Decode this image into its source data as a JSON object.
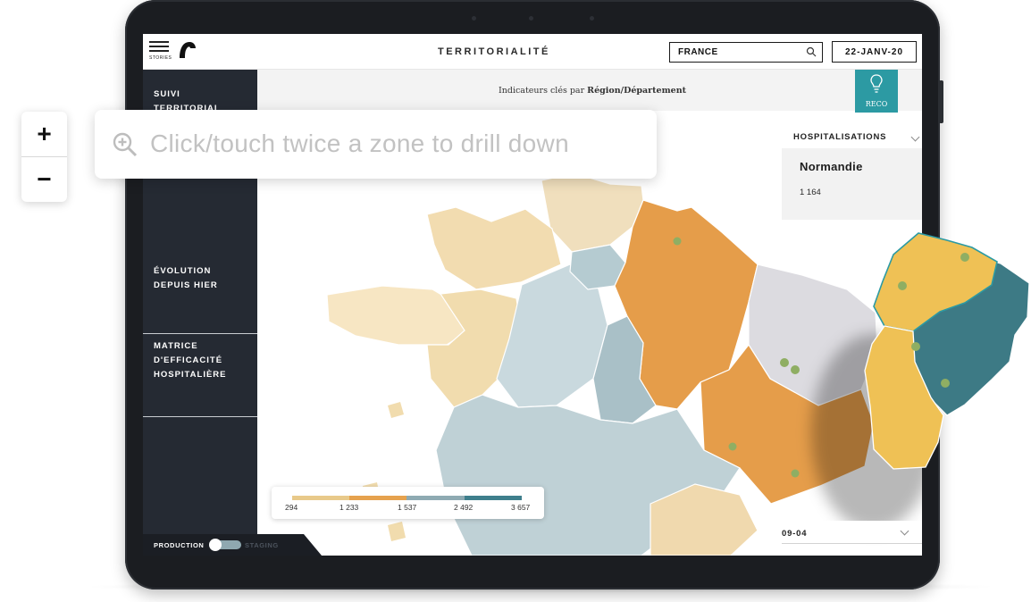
{
  "app": {
    "logo_label": "STORIES",
    "page_title": "TERRITORIALITÉ",
    "search_value": "FRANCE",
    "date_value": "22-JANV-20"
  },
  "sidebar": {
    "items": [
      {
        "label_line1": "SUIVI",
        "label_line2": "TERRITORIAL"
      },
      {
        "label_line1": "ÉVOLUTION",
        "label_line2": "DEPUIS HIER"
      },
      {
        "label_line1": "MATRICE",
        "label_line2": "D'EFFICACITÉ",
        "label_line3": "HOSPITALIÈRE"
      }
    ],
    "toggle": {
      "left_label": "PRODUCTION",
      "right_label": "STAGING"
    }
  },
  "header": {
    "indicator_prefix": "Indicateurs clés par",
    "indicator_bold": "Région/Département",
    "reco_label": "RECO"
  },
  "hint": {
    "text": "Click/touch twice a zone to drill down",
    "icon": "zoom-in-icon"
  },
  "zoom": {
    "plus": "+",
    "minus": "−"
  },
  "panel": {
    "metric": "HOSPITALISATIONS",
    "region_name": "Normandie",
    "region_value": "1 164",
    "period": "09-04"
  },
  "legend": {
    "ticks": [
      "294",
      "1 233",
      "1 537",
      "2 492",
      "3 657"
    ],
    "colors": [
      "#e8c98a",
      "#e6a24e",
      "#8eaab2",
      "#3e7f8c"
    ]
  },
  "colors": {
    "sidebar": "#252a33",
    "accent_teal": "#2c9aa3",
    "orange": "#e39a48",
    "light_blue": "#b7cbd1",
    "yellow": "#efc155",
    "dark_teal": "#3d7a85"
  }
}
